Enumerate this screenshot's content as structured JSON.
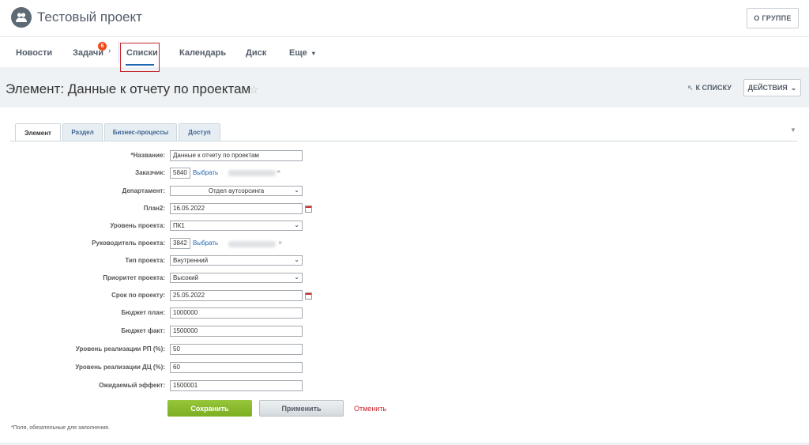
{
  "header": {
    "title": "Тестовый проект",
    "about_button": "О ГРУППЕ",
    "avatar_icon": "group-users-icon"
  },
  "nav": {
    "items": [
      {
        "label": "Новости"
      },
      {
        "label": "Задачи",
        "counter": "6"
      },
      {
        "label": "Списки",
        "active": true
      },
      {
        "label": "Календарь"
      },
      {
        "label": "Диск"
      },
      {
        "label": "Еще"
      }
    ],
    "accent_color": "#2067b0",
    "highlight_color": "#c7262d"
  },
  "page": {
    "title": "Элемент: Данные к отчету по проектам",
    "back_link": "К СПИСКУ",
    "actions_button": "ДЕЙСТВИЯ"
  },
  "tabs": [
    {
      "label": "Элемент",
      "active": true
    },
    {
      "label": "Раздел"
    },
    {
      "label": "Бизнес-процессы"
    },
    {
      "label": "Доступ"
    }
  ],
  "form": {
    "name": {
      "label": "*Название:",
      "value": "Данные к отчету по проектам"
    },
    "customer": {
      "label": "Заказчик:",
      "value": "5840",
      "pick": "Выбрать"
    },
    "department": {
      "label": "Департамент:",
      "value": "Отдел аутсорсинга"
    },
    "plan2": {
      "label": "План2:",
      "value": "16.05.2022"
    },
    "project_level": {
      "label": "Уровень проекта:",
      "value": "ПК1"
    },
    "project_manager": {
      "label": "Руководитель проекта:",
      "value": "3842",
      "pick": "Выбрать"
    },
    "project_type": {
      "label": "Тип проекта:",
      "value": "Внутренний"
    },
    "project_priority": {
      "label": "Приоритет проекта:",
      "value": "Высокий"
    },
    "deadline": {
      "label": "Срок по проекту:",
      "value": "25.05.2022"
    },
    "budget_plan": {
      "label": "Бюджет план:",
      "value": "1000000"
    },
    "budget_fact": {
      "label": "Бюджет факт:",
      "value": "1500000"
    },
    "rp_level": {
      "label": "Уровень реализации РП (%):",
      "value": "50"
    },
    "dc_level": {
      "label": "Уровень реализации ДЦ (%):",
      "value": "60"
    },
    "expected_effect": {
      "label": "Ожидаемый эффект:",
      "value": "1500001"
    }
  },
  "buttons": {
    "save": "Сохранить",
    "apply": "Применить",
    "cancel": "Отменить"
  },
  "footnote": "*Поля, обязательные для заполнения."
}
